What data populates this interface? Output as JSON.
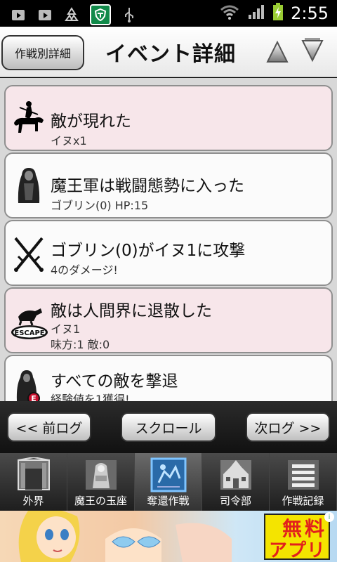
{
  "status_bar": {
    "time": "2:55",
    "icons": [
      "play-store-icon",
      "play-store-icon",
      "recycle-icon",
      "shield-icon",
      "usb-icon",
      "wifi-icon",
      "signal-icon",
      "battery-charging-icon"
    ]
  },
  "header": {
    "mode_button": "作戦別詳細",
    "title": "イベント詳細"
  },
  "events": [
    {
      "title": "敵が現れた",
      "lines": [
        "イヌx1"
      ],
      "style": "pink",
      "icon": "rider-icon"
    },
    {
      "title": "魔王軍は戦闘態勢に入った",
      "lines": [
        "ゴブリン(0) HP:15"
      ],
      "style": "white",
      "icon": "cloaked-figure-icon"
    },
    {
      "title": "ゴブリン(0)がイヌ1に攻撃",
      "lines": [
        "4のダメージ!"
      ],
      "style": "white",
      "icon": "crossed-swords-icon"
    },
    {
      "title": "敵は人間界に退散した",
      "lines": [
        "イヌ1",
        "味方:1 敵:0"
      ],
      "style": "pink",
      "icon": "escape-icon",
      "icon_label": "ESCAPE"
    },
    {
      "title": "すべての敵を撃退",
      "lines": [
        "経験値を1獲得!"
      ],
      "style": "white",
      "icon": "experience-icon",
      "icon_label": "E"
    }
  ],
  "nav_buttons": {
    "prev": "<< 前ログ",
    "scroll": "スクロール",
    "next": "次ログ >>"
  },
  "tabs": [
    {
      "label": "外界",
      "icon": "gate-icon",
      "active": false
    },
    {
      "label": "魔王の玉座",
      "icon": "throne-icon",
      "active": false
    },
    {
      "label": "奪還作戦",
      "icon": "recapture-icon",
      "active": true
    },
    {
      "label": "司令部",
      "icon": "headquarters-icon",
      "active": false
    },
    {
      "label": "作戦記録",
      "icon": "records-icon",
      "active": false
    }
  ],
  "ad": {
    "line1": "無料",
    "line2": "アプリ",
    "info": "i"
  }
}
